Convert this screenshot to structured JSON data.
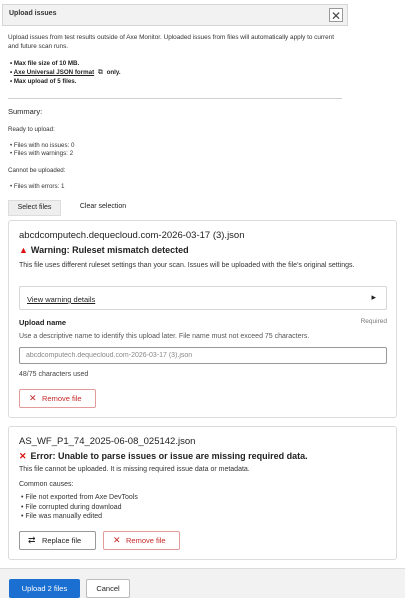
{
  "dialog": {
    "title": "Upload issues",
    "close_glyph": "✕",
    "intro": "Upload issues from test results outside of Axe Monitor. Uploaded issues from files will automatically apply to current and future scan runs.",
    "limits": {
      "max_size": "Max file size of 10 MB.",
      "format_link": "Axe Universal JSON format",
      "format_suffix": "only.",
      "max_files": "Max upload of 5 files."
    }
  },
  "summary": {
    "heading": "Summary:",
    "ready_label": "Ready to upload:",
    "no_issues": "Files with no issues: 0",
    "with_warnings": "Files with warnings: 2",
    "cannot_label": "Cannot be uploaded:",
    "with_errors": "Files with errors: 1"
  },
  "actions": {
    "select_files": "Select files",
    "clear_selection": "Clear selection"
  },
  "file1": {
    "name": "abcdcomputech.dequecloud.com-2026-03-17 (3).json",
    "warning_title": "Warning: Ruleset mismatch detected",
    "warning_text": "This file uses different ruleset settings than your scan. Issues will be uploaded with the file's original settings.",
    "details_link": "View warning details",
    "upload_name_label": "Upload name",
    "required": "Required",
    "upload_name_help": "Use a descriptive name to identify this upload later. File name must not exceed 75 characters.",
    "upload_name_value": "abcdcomputech.dequecloud.com-2026-03-17 (3).json",
    "char_count": "48/75 characters used",
    "remove": "Remove file"
  },
  "file2": {
    "name": "AS_WF_P1_74_2025-06-08_025142.json",
    "error_title": "Error: Unable to parse issues or issue are missing required data.",
    "error_text": "This file cannot be uploaded. It is missing required issue data or metadata.",
    "causes_label": "Common causes:",
    "causes": [
      "File not exported from Axe DevTools",
      "File corrupted during download",
      "File was manually edited"
    ],
    "replace": "Replace file",
    "remove": "Remove file"
  },
  "footer": {
    "upload": "Upload 2 files",
    "cancel": "Cancel"
  },
  "colors": {
    "primary": "#1b6fd1",
    "danger": "#c62828",
    "warning_icon": "#dd1111"
  },
  "icons": {
    "close": "close-icon",
    "external_link": "external-link-icon",
    "warning": "warning-triangle-icon",
    "chevron": "chevron-right-icon",
    "error": "error-x-icon",
    "remove": "remove-x-icon",
    "replace": "replace-icon"
  }
}
